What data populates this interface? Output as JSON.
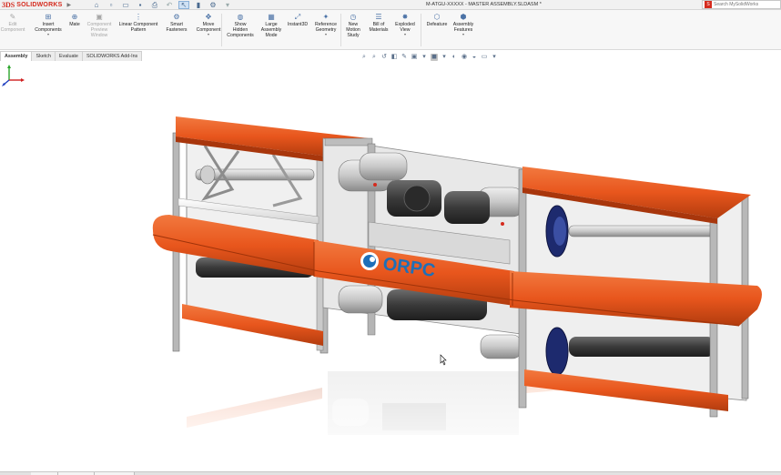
{
  "app": {
    "logo_mark": "3DS",
    "brand": "SOLIDWORKS",
    "document_title": "M-ATGU-XXXXX - MASTER ASSEMBLY.SLDASM *"
  },
  "search": {
    "placeholder": "Search MySolidWorks"
  },
  "ribbon": {
    "buttons": [
      {
        "label": "Edit\nComponent",
        "icon": "edit-component-icon",
        "disabled": true
      },
      {
        "label": "Insert\nComponents",
        "icon": "insert-components-icon",
        "disabled": false
      },
      {
        "label": "Mate",
        "icon": "mate-icon",
        "disabled": false
      },
      {
        "label": "Component\nPreview\nWindow",
        "icon": "component-preview-icon",
        "disabled": true
      },
      {
        "label": "Linear Component\nPattern",
        "icon": "linear-pattern-icon",
        "disabled": false
      },
      {
        "label": "Smart\nFasteners",
        "icon": "smart-fasteners-icon",
        "disabled": false
      },
      {
        "label": "Move\nComponent",
        "icon": "move-component-icon",
        "disabled": false
      },
      {
        "label": "Show\nHidden\nComponents",
        "icon": "show-hidden-icon",
        "disabled": false
      },
      {
        "label": "Large\nAssembly\nMode",
        "icon": "large-assembly-icon",
        "disabled": false
      },
      {
        "label": "Instant3D",
        "icon": "instant3d-icon",
        "disabled": false
      },
      {
        "label": "Reference\nGeometry",
        "icon": "reference-geometry-icon",
        "disabled": false
      },
      {
        "label": "New\nMotion\nStudy",
        "icon": "motion-study-icon",
        "disabled": false
      },
      {
        "label": "Bill of\nMaterials",
        "icon": "bill-of-materials-icon",
        "disabled": false
      },
      {
        "label": "Exploded\nView",
        "icon": "exploded-view-icon",
        "disabled": false
      },
      {
        "label": "Defeature",
        "icon": "defeature-icon",
        "disabled": false
      },
      {
        "label": "Assembly\nFeatures",
        "icon": "assembly-features-icon",
        "disabled": false
      }
    ]
  },
  "command_tabs": [
    {
      "label": "Assembly",
      "active": true
    },
    {
      "label": "Sketch",
      "active": false
    },
    {
      "label": "Evaluate",
      "active": false
    },
    {
      "label": "SOLIDWORKS Add-Ins",
      "active": false
    }
  ],
  "model": {
    "logo_text": "ORPC",
    "colors": {
      "orange": "#e8561d",
      "frame": "#9c9c9c",
      "logo_blue": "#1e6fb8",
      "accent": "#d52b1e"
    }
  }
}
